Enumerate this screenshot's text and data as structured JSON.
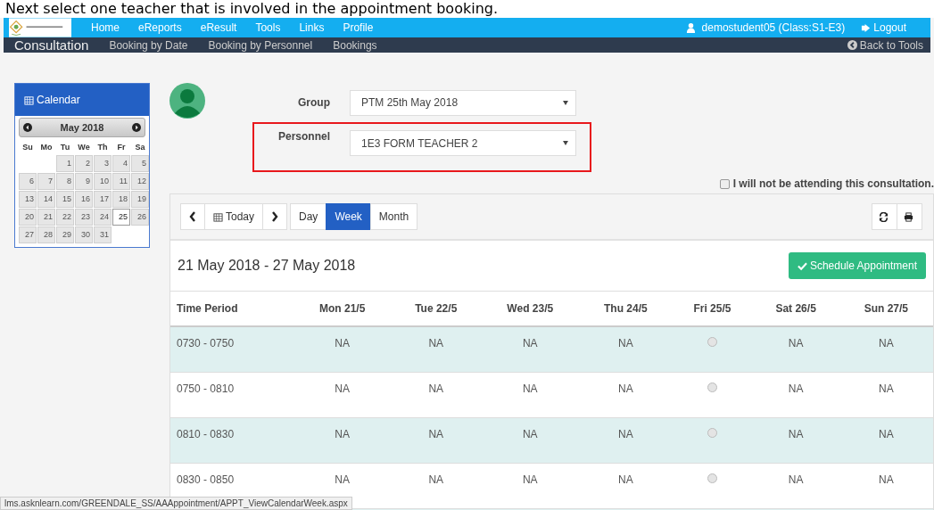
{
  "caption": "Next select one teacher that is involved in the appointment booking.",
  "top_nav": {
    "items": [
      "Home",
      "eReports",
      "eResult",
      "Tools",
      "Links",
      "Profile"
    ],
    "user": "demostudent05 (Class:S1-E3)",
    "logout": "Logout"
  },
  "sub_nav": {
    "title": "Consultation",
    "items": [
      "Booking by Date",
      "Booking by Personnel",
      "Bookings"
    ],
    "back": "Back to Tools"
  },
  "calendar_widget": {
    "title": "Calendar",
    "month": "May 2018",
    "weekdays": [
      "Su",
      "Mo",
      "Tu",
      "We",
      "Th",
      "Fr",
      "Sa"
    ],
    "weeks": [
      [
        {
          "kind": "blank"
        },
        {
          "kind": "blank"
        },
        {
          "label": "1",
          "selected": false
        },
        {
          "label": "2",
          "selected": false
        },
        {
          "label": "3",
          "selected": false
        },
        {
          "label": "4",
          "selected": false
        },
        {
          "label": "5",
          "selected": false
        }
      ],
      [
        {
          "label": "6",
          "selected": false
        },
        {
          "label": "7",
          "selected": false
        },
        {
          "label": "8",
          "selected": false
        },
        {
          "label": "9",
          "selected": false
        },
        {
          "label": "10",
          "selected": false
        },
        {
          "label": "11",
          "selected": false
        },
        {
          "label": "12",
          "selected": false
        }
      ],
      [
        {
          "label": "13",
          "selected": false
        },
        {
          "label": "14",
          "selected": false
        },
        {
          "label": "15",
          "selected": false
        },
        {
          "label": "16",
          "selected": false
        },
        {
          "label": "17",
          "selected": false
        },
        {
          "label": "18",
          "selected": false
        },
        {
          "label": "19",
          "selected": false
        }
      ],
      [
        {
          "label": "20",
          "selected": false
        },
        {
          "label": "21",
          "selected": false
        },
        {
          "label": "22",
          "selected": false
        },
        {
          "label": "23",
          "selected": false
        },
        {
          "label": "24",
          "selected": false
        },
        {
          "label": "25",
          "selected": true
        },
        {
          "label": "26",
          "selected": false
        }
      ],
      [
        {
          "label": "27",
          "selected": false
        },
        {
          "label": "28",
          "selected": false
        },
        {
          "label": "29",
          "selected": false
        },
        {
          "label": "30",
          "selected": false
        },
        {
          "label": "31",
          "selected": false
        },
        {
          "kind": "blank"
        },
        {
          "kind": "blank"
        }
      ]
    ]
  },
  "filters": [
    {
      "label": "Group",
      "value": "PTM 25th May 2018",
      "highlighted": false
    },
    {
      "label": "Personnel",
      "value": "1E3 FORM TEACHER 2",
      "highlighted": true
    }
  ],
  "not_attending": {
    "label": "I will not be attending this consultation.",
    "checked": false
  },
  "toolbar": {
    "today": "Today",
    "views": [
      {
        "label": "Day",
        "selected": false
      },
      {
        "label": "Week",
        "selected": true
      },
      {
        "label": "Month",
        "selected": false
      }
    ]
  },
  "range": "21 May 2018 - 27 May 2018",
  "schedule_button": "Schedule Appointment",
  "table": {
    "columns": [
      "Time Period",
      "Mon 21/5",
      "Tue 22/5",
      "Wed 23/5",
      "Thu 24/5",
      "Fri 25/5",
      "Sat 26/5",
      "Sun 27/5"
    ],
    "rows": [
      {
        "cells": [
          {
            "kind": "time",
            "text": "0730 - 0750"
          },
          {
            "kind": "text",
            "text": "NA"
          },
          {
            "kind": "text",
            "text": "NA"
          },
          {
            "kind": "text",
            "text": "NA"
          },
          {
            "kind": "text",
            "text": "NA"
          },
          {
            "kind": "slot",
            "selected": false
          },
          {
            "kind": "text",
            "text": "NA"
          },
          {
            "kind": "text",
            "text": "NA"
          }
        ]
      },
      {
        "cells": [
          {
            "kind": "time",
            "text": "0750 - 0810"
          },
          {
            "kind": "text",
            "text": "NA"
          },
          {
            "kind": "text",
            "text": "NA"
          },
          {
            "kind": "text",
            "text": "NA"
          },
          {
            "kind": "text",
            "text": "NA"
          },
          {
            "kind": "slot",
            "selected": false
          },
          {
            "kind": "text",
            "text": "NA"
          },
          {
            "kind": "text",
            "text": "NA"
          }
        ]
      },
      {
        "cells": [
          {
            "kind": "time",
            "text": "0810 - 0830"
          },
          {
            "kind": "text",
            "text": "NA"
          },
          {
            "kind": "text",
            "text": "NA"
          },
          {
            "kind": "text",
            "text": "NA"
          },
          {
            "kind": "text",
            "text": "NA"
          },
          {
            "kind": "slot",
            "selected": false
          },
          {
            "kind": "text",
            "text": "NA"
          },
          {
            "kind": "text",
            "text": "NA"
          }
        ]
      },
      {
        "cells": [
          {
            "kind": "time",
            "text": "0830 - 0850"
          },
          {
            "kind": "text",
            "text": "NA"
          },
          {
            "kind": "text",
            "text": "NA"
          },
          {
            "kind": "text",
            "text": "NA"
          },
          {
            "kind": "text",
            "text": "NA"
          },
          {
            "kind": "slot",
            "selected": false
          },
          {
            "kind": "text",
            "text": "NA"
          },
          {
            "kind": "text",
            "text": "NA"
          }
        ]
      }
    ]
  },
  "status_url": "lms.asknlearn.com/GREENDALE_SS/AAAppointment/APPT_ViewCalendarWeek.aspx"
}
